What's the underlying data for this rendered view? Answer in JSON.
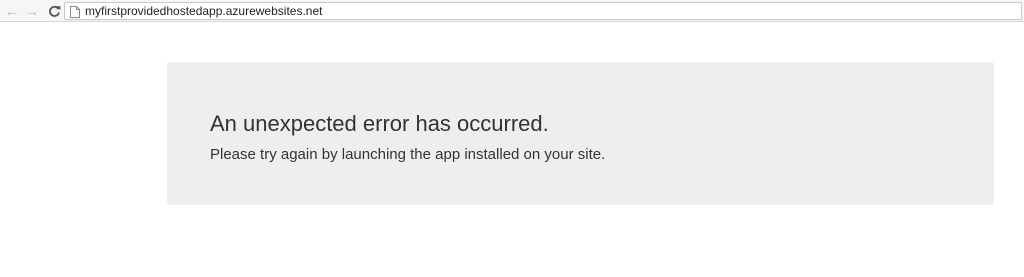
{
  "browser": {
    "back_icon": "back-arrow-icon",
    "forward_icon": "forward-arrow-icon",
    "reload_icon": "reload-icon",
    "page_icon": "page-document-icon",
    "url": "myfirstprovidedhostedapp.azurewebsites.net"
  },
  "error": {
    "title": "An unexpected error has occurred.",
    "message": "Please try again by launching the app installed on your site."
  },
  "colors": {
    "panel_background": "#eeeeee",
    "text": "#333333"
  }
}
